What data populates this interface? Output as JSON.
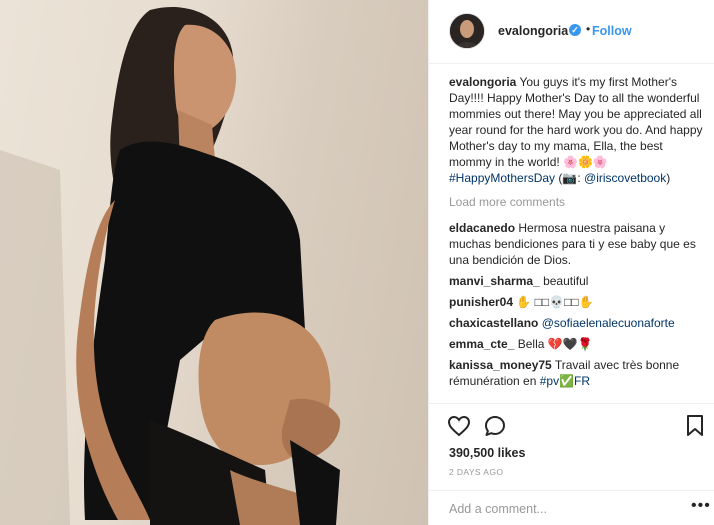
{
  "header": {
    "username": "evalongoria",
    "dot": "•",
    "follow_label": "Follow",
    "verified_mark": "✓"
  },
  "caption": {
    "username": "evalongoria",
    "text": "You guys it's my first Mother's Day!!!! Happy Mother's Day to all the wonderful mommies out there! May you be appreciated all year round for the hard work you do. And happy Mother's day to my mama, Ella, the best mommy in the world! 🌸🌼🌸 ",
    "hashtag": "#HappyMothersDay",
    "credit_prefix": " (📷: ",
    "credit_handle": "@iriscovetbook",
    "credit_suffix": ")"
  },
  "load_more_label": "Load more comments",
  "comments": [
    {
      "username": "eldacanedo",
      "text": "Hermosa nuestra paisana y muchas bendiciones para ti y ese baby que es una bendición de Dios."
    },
    {
      "username": "manvi_sharma_",
      "text": "beautiful"
    },
    {
      "username": "punisher04",
      "text": "✋ □□💀□□✋"
    },
    {
      "username": "chaxicastellano",
      "text": "",
      "mention": "@sofiaelenalecuonaforte"
    },
    {
      "username": "emma_cte_",
      "text": "Bella 💔🖤🌹"
    },
    {
      "username": "kanissa_money75",
      "text": "Travail avec très bonne rémunération en ",
      "mention": "#pv✅FR"
    }
  ],
  "likes_label": "390,500 likes",
  "time_ago": "2 DAYS AGO",
  "add_comment_placeholder": "Add a comment...",
  "more_options": "•••",
  "icons": [
    "heart-icon",
    "comment-icon",
    "bookmark-icon",
    "verified-badge-icon",
    "more-options-icon"
  ],
  "colors": {
    "accent": "#3897f0",
    "muted": "#999999",
    "hashtag": "#003569"
  }
}
